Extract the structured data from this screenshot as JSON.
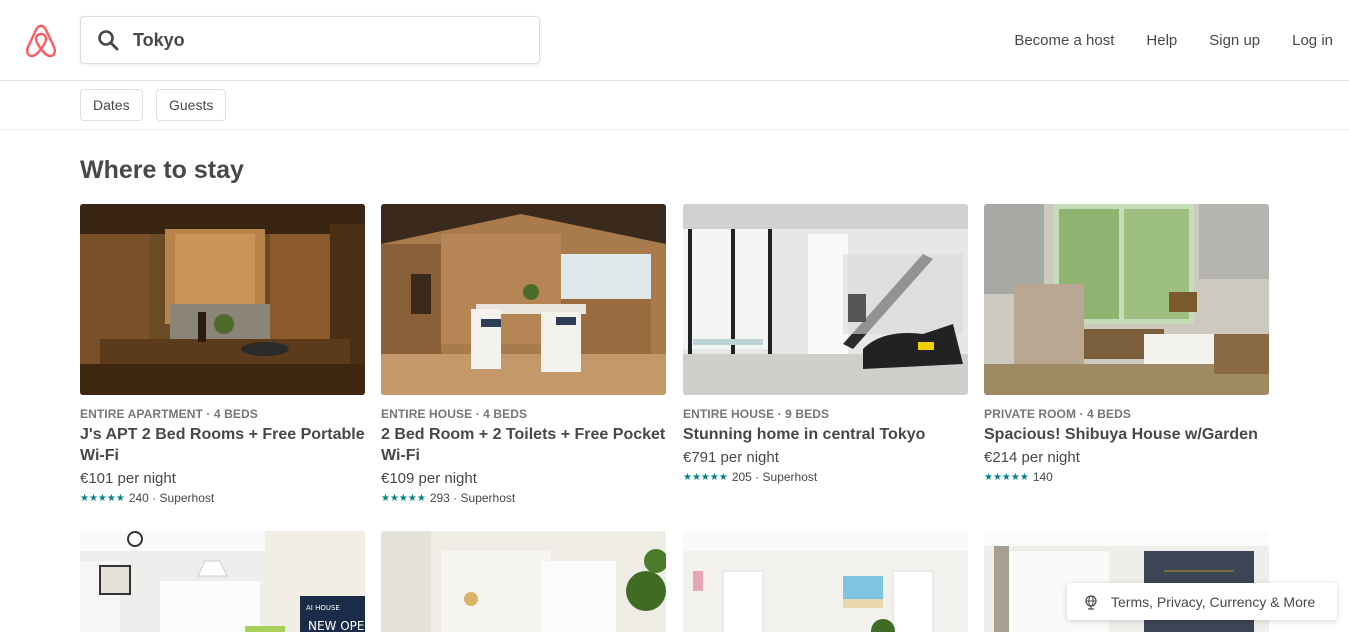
{
  "header": {
    "logo": "airbnb-logo",
    "search_value": "Tokyo",
    "nav": [
      "Become a host",
      "Help",
      "Sign up",
      "Log in"
    ]
  },
  "filters": [
    "Dates",
    "Guests"
  ],
  "section_title": "Where to stay",
  "listings": [
    {
      "type": "ENTIRE APARTMENT · 4 BEDS",
      "title": "J's APT 2 Bed Rooms + Free Portable Wi-Fi",
      "price": "€101 per night",
      "stars": "★★★★★",
      "rating": "240 · Superhost"
    },
    {
      "type": "ENTIRE HOUSE · 4 BEDS",
      "title": "2 Bed Room + 2 Toilets + Free Pocket Wi-Fi",
      "price": "€109 per night",
      "stars": "★★★★★",
      "rating": "293 · Superhost"
    },
    {
      "type": "ENTIRE HOUSE · 9 BEDS",
      "title": "Stunning home in central Tokyo",
      "price": "€791 per night",
      "stars": "★★★★★",
      "rating": "205 · Superhost"
    },
    {
      "type": "PRIVATE ROOM · 4 BEDS",
      "title": "Spacious! Shibuya House w/Garden",
      "price": "€214 per night",
      "stars": "★★★★★",
      "rating": "140"
    }
  ],
  "second_row_sign": "NEW OPE",
  "footer": "Terms, Privacy, Currency & More",
  "colors": {
    "brand": "#FF5A5F",
    "rating": "#008489",
    "text": "#484848"
  }
}
